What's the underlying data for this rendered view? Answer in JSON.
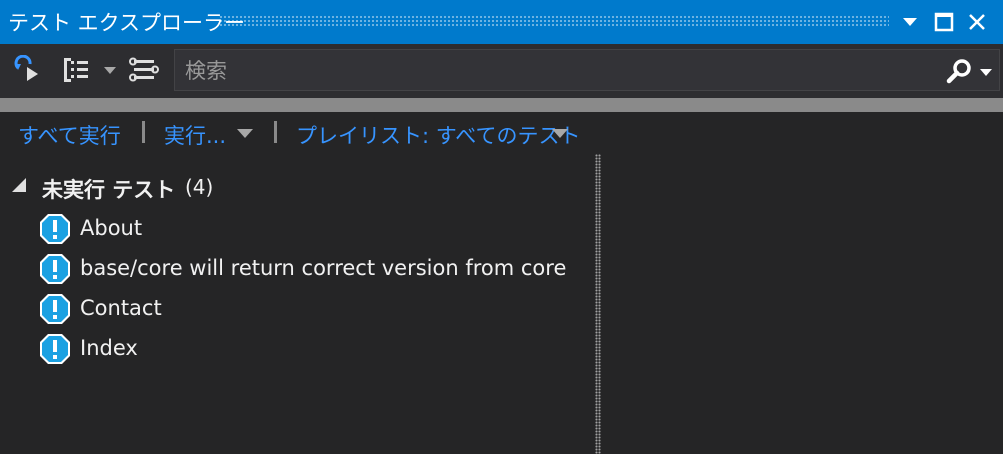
{
  "window": {
    "title": "テスト エクスプローラー",
    "accent_color": "#007acc",
    "buttons": [
      "window-position-dropdown",
      "maximize",
      "close"
    ]
  },
  "toolbar": {
    "icons": [
      "run-tests-icon",
      "group-by-icon",
      "dropdown-arrow-icon",
      "playlist-settings-icon"
    ],
    "search": {
      "placeholder": "検索",
      "value": "",
      "icon": "search-icon"
    }
  },
  "commands": {
    "run_all": "すべて実行",
    "run": "実行...",
    "playlist": "プレイリスト: すべてのテスト"
  },
  "tree": {
    "group": {
      "label": "未実行 テスト",
      "count": "(4)"
    },
    "tests": [
      {
        "name": "About",
        "status": "not-run"
      },
      {
        "name": "base/core will return correct version from core",
        "status": "not-run"
      },
      {
        "name": "Contact",
        "status": "not-run"
      },
      {
        "name": "Index",
        "status": "not-run"
      }
    ]
  }
}
